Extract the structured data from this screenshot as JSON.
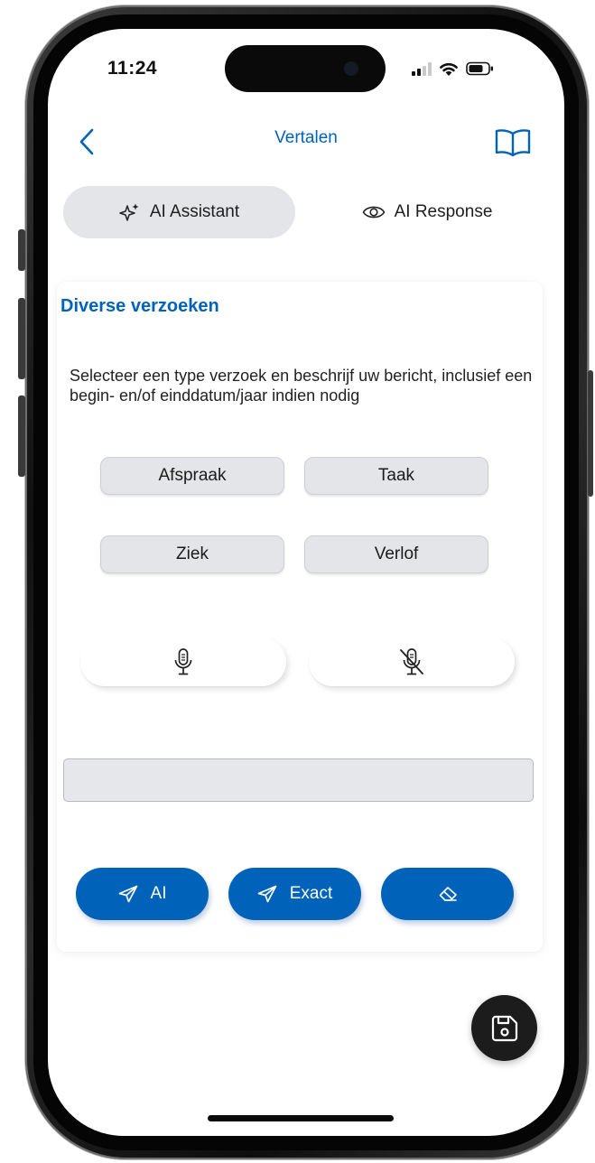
{
  "status_bar": {
    "time": "11:24",
    "signal_icon": "cellular-signal-icon",
    "wifi_icon": "wifi-icon",
    "battery_icon": "battery-icon"
  },
  "nav": {
    "back_icon": "chevron-left-icon",
    "title": "Vertalen",
    "book_icon": "open-book-icon"
  },
  "tabs": [
    {
      "label": "AI Assistant",
      "icon": "sparkles-icon",
      "active": true
    },
    {
      "label": "AI Response",
      "icon": "eye-icon",
      "active": false
    }
  ],
  "card": {
    "title": "Diverse verzoeken",
    "description": "Selecteer een type verzoek en beschrijf uw bericht, inclusief een begin- en/of einddatum/jaar indien nodig",
    "request_types": [
      "Afspraak",
      "Taak",
      "Ziek",
      "Verlof"
    ],
    "mic_buttons": {
      "record_icon": "microphone-icon",
      "stop_icon": "microphone-off-icon"
    },
    "message_input": {
      "value": "",
      "placeholder": ""
    },
    "actions": {
      "ai_label": "AI",
      "exact_label": "Exact",
      "send_icon": "paper-plane-icon",
      "clear_icon": "eraser-icon"
    }
  },
  "fab": {
    "icon": "save-icon"
  },
  "colors": {
    "accent": "#0063b9",
    "chip_background": "#e4e5e8",
    "active_tab_background": "#e4e5e8",
    "fab_background": "#1c1c1c"
  }
}
